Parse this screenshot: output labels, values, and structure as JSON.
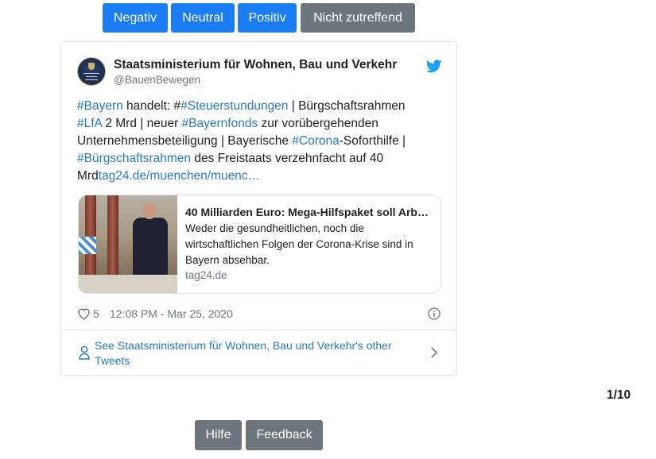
{
  "sentiment_buttons": {
    "negative": "Negativ",
    "neutral": "Neutral",
    "positive": "Positiv",
    "not_applicable": "Nicht zutreffend"
  },
  "tweet": {
    "author_name": "Staatsministerium für Wohnen, Bau und Verkehr",
    "author_handle": "@BauenBewegen",
    "avatar_icon": "ministry-crest-logo",
    "text_segments": {
      "s1": "#Bayern",
      "s2": " handelt: #",
      "s3": "#Steuerstundungen",
      "s4": " | Bürgschaftsrahmen",
      "s5": "#LfA",
      "s6": " 2 Mrd | neuer ",
      "s7": "#Bayernfonds",
      "s8": " zur vorübergehenden",
      "s9": "Unternehmensbeteiligung | Bayerische ",
      "s10": "#Corona",
      "s11": "-Soforthilfe |",
      "s12": "#Bürgschaftsrahmen",
      "s13": " des Freistaats verzehnfacht auf 40",
      "s14": "Mrd",
      "s15": "tag24.de/muenchen/muenc…"
    },
    "link_card": {
      "title": "40 Milliarden Euro: Mega-Hilfspaket soll Arb…",
      "description": "Weder die gesundheitlichen, noch die wirtschaftlichen Folgen der Corona-Krise sind in Bayern absehbar.",
      "domain": "tag24.de"
    },
    "likes": "5",
    "timestamp": "12:08 PM - Mar 25, 2020",
    "footer_link": "See Staatsministerium für Wohnen, Bau und Verkehr's other Tweets"
  },
  "pager": "1/10",
  "bottom_buttons": {
    "help": "Hilfe",
    "feedback": "Feedback"
  },
  "colors": {
    "primary_button": "#1a7df3",
    "secondary_button": "#6e767d",
    "link": "#2b7bb9",
    "twitter_blue": "#1da1f2",
    "muted_text": "#697882"
  }
}
